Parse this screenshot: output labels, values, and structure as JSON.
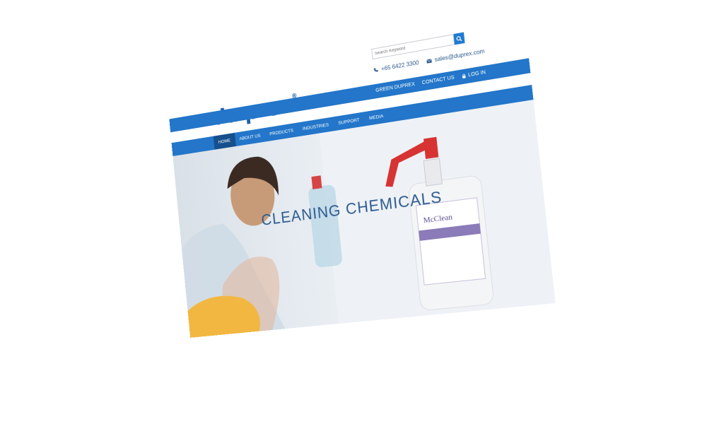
{
  "header": {
    "logo_text": "du prex",
    "logo_mark": "®",
    "search": {
      "placeholder": "Search Keyword"
    },
    "phone": "+65 6422 3300",
    "email": "sales@duprex.com"
  },
  "topbar": {
    "items": [
      {
        "label": "GREEN DUPREX"
      },
      {
        "label": "CONTACT US"
      },
      {
        "label": "LOG IN"
      }
    ]
  },
  "nav": {
    "items": [
      {
        "label": "HOME",
        "active": true
      },
      {
        "label": "ABOUT US"
      },
      {
        "label": "PRODUCTS"
      },
      {
        "label": "INDUSTRIES"
      },
      {
        "label": "SUPPORT"
      },
      {
        "label": "MEDIA"
      }
    ]
  },
  "hero": {
    "title": "CLEANING CHEMICALS",
    "bottle_brand": "McClean"
  },
  "colors": {
    "brand": "#1f5fa8",
    "nav": "#2376c9",
    "nav_active": "#164f8c"
  }
}
